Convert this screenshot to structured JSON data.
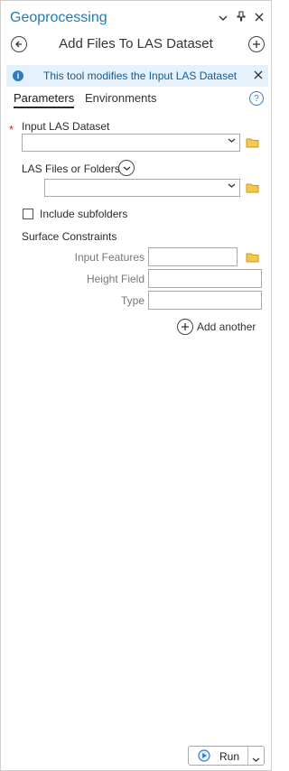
{
  "pane": {
    "title": "Geoprocessing",
    "tool_title": "Add Files To LAS Dataset",
    "controls": {
      "chevron": "⌄",
      "pin": "⊥",
      "close": "✕"
    }
  },
  "info": {
    "message": "This tool modifies the Input LAS Dataset"
  },
  "tabs": [
    {
      "label": "Parameters"
    },
    {
      "label": "Environments"
    }
  ],
  "params": {
    "input_las_dataset": {
      "label": "Input LAS Dataset",
      "value": ""
    },
    "las_files": {
      "label": "LAS Files or Folders",
      "value": ""
    },
    "include_subfolders": {
      "label": "Include subfolders",
      "checked": false
    },
    "surface_constraints": {
      "label": "Surface Constraints",
      "fields": [
        {
          "label": "Input Features",
          "value": ""
        },
        {
          "label": "Height Field",
          "value": ""
        },
        {
          "label": "Type",
          "value": ""
        }
      ],
      "add_another": "Add another"
    }
  },
  "run": {
    "label": "Run"
  },
  "colors": {
    "accent": "#1f7ab8",
    "info_bg": "#e5f1fb",
    "required": "#c62828",
    "folder": "#e8b93a"
  }
}
